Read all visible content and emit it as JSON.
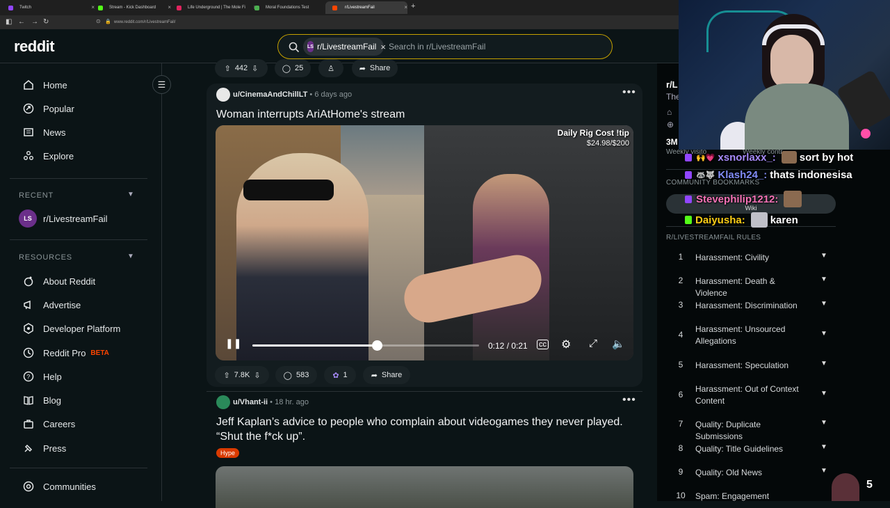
{
  "browser": {
    "tabs": [
      {
        "label": "Twitch",
        "color": "#9146ff"
      },
      {
        "label": "Stream - Kick Dashboard",
        "color": "#53fc18"
      },
      {
        "label": "Life Underground | The Mole Fi",
        "color": "#e0245e"
      },
      {
        "label": "Moral Foundations Test",
        "color": "#4caf50"
      },
      {
        "label": "r/LivestreamFail",
        "color": "#ff4500"
      }
    ],
    "new_tab": "+",
    "url": "www.reddit.com/r/LivestreamFail/"
  },
  "header": {
    "logo": "reddit",
    "chip_badge": "LS",
    "chip_label": "r/LivestreamFail",
    "search_placeholder": "Search in r/LivestreamFail"
  },
  "sidebar": {
    "main": [
      {
        "label": "Home",
        "icon": "home-icon"
      },
      {
        "label": "Popular",
        "icon": "popular-icon"
      },
      {
        "label": "News",
        "icon": "news-icon"
      },
      {
        "label": "Explore",
        "icon": "explore-icon"
      }
    ],
    "recent_heading": "RECENT",
    "recent_item": "r/LivestreamFail",
    "resources_heading": "RESOURCES",
    "resources": [
      {
        "label": "About Reddit",
        "icon": "about-icon"
      },
      {
        "label": "Advertise",
        "icon": "advertise-icon"
      },
      {
        "label": "Developer Platform",
        "icon": "developer-icon"
      },
      {
        "label": "Reddit Pro",
        "icon": "pro-icon",
        "badge": "BETA"
      },
      {
        "label": "Help",
        "icon": "help-icon"
      },
      {
        "label": "Blog",
        "icon": "blog-icon"
      },
      {
        "label": "Careers",
        "icon": "careers-icon"
      },
      {
        "label": "Press",
        "icon": "press-icon"
      }
    ],
    "communities": "Communities"
  },
  "feed": {
    "prev_post": {
      "votes": "442",
      "comments": "25",
      "share": "Share"
    },
    "post1": {
      "author": "u/CinemaAndChillLT",
      "age": "• 6 days ago",
      "title": "Woman interrupts AriAtHome's stream",
      "overlay_title": "Daily Rig Cost !tip",
      "overlay_amount": "$24.98/$200",
      "time": "0:12 / 0:21",
      "progress": 0.55,
      "votes": "7.8K",
      "comments": "583",
      "awards": "1",
      "share": "Share"
    },
    "post2": {
      "author": "u/Vhant-ii",
      "age": "• 18 hr. ago",
      "title": "Jeff Kaplan’s advice to people who complain about videogames they never played. “Shut the f*ck up”.",
      "flair": "Hype"
    },
    "more": "•••"
  },
  "rightbar": {
    "sub_abbrev": "r/L",
    "sub_desc": "The",
    "members": "3M",
    "weekly": "Weekly visito",
    "weekly2": "Weekly contr",
    "bookmarks_heading": "COMMUNITY BOOKMARKS",
    "wiki": "Wiki",
    "rules_heading": "R/LIVESTREAMFAIL RULES",
    "rules": [
      {
        "num": "1",
        "text": "Harassment: Civility"
      },
      {
        "num": "2",
        "text": "Harassment: Death & Violence"
      },
      {
        "num": "3",
        "text": "Harassment: Discrimination"
      },
      {
        "num": "4",
        "text": "Harassment: Unsourced Allegations"
      },
      {
        "num": "5",
        "text": "Harassment: Speculation"
      },
      {
        "num": "6",
        "text": "Harassment: Out of Context Content"
      },
      {
        "num": "7",
        "text": "Quality: Duplicate Submissions"
      },
      {
        "num": "8",
        "text": "Quality: Title Guidelines"
      },
      {
        "num": "9",
        "text": "Quality: Old News"
      },
      {
        "num": "10",
        "text": "Spam: Engagement"
      }
    ]
  },
  "stream_chat": [
    {
      "user": "xsnorlaxx_:",
      "msg": "sort by hot",
      "color": "#a78bfa"
    },
    {
      "user": "Klash24_:",
      "msg": "thats indonesisa",
      "color": "#818cf8"
    },
    {
      "user": "Stevephilip1212:",
      "msg": "",
      "color": "#f472b6"
    },
    {
      "user": "Daiyusha:",
      "msg": "karen",
      "color": "#facc15"
    }
  ],
  "viewer_count": "5"
}
